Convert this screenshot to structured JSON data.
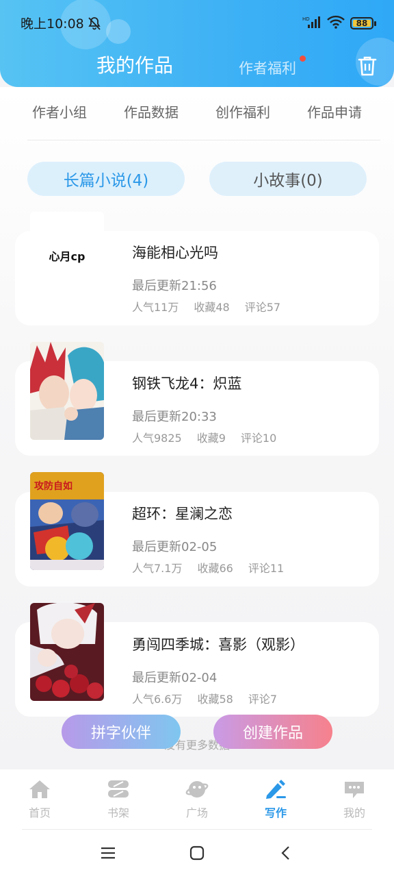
{
  "status_bar": {
    "time": "晚上10:08",
    "battery": "88",
    "network_label": "HD"
  },
  "header": {
    "tab_works": "我的作品",
    "tab_benefits": "作者福利",
    "trash_icon": "trash-icon"
  },
  "subnav": [
    "作者小组",
    "作品数据",
    "创作福利",
    "作品申请"
  ],
  "categories": {
    "novel": "长篇小说(4)",
    "story": "小故事(0)"
  },
  "works": [
    {
      "cover_text": "心月cp",
      "title": "海能相心光吗",
      "updated": "最后更新21:56",
      "popularity": "人气11万",
      "favorites": "收藏48",
      "comments": "评论57"
    },
    {
      "title": "钢铁飞龙4：炽蓝",
      "updated": "最后更新20:33",
      "popularity": "人气9825",
      "favorites": "收藏9",
      "comments": "评论10"
    },
    {
      "cover_text": "攻防自如",
      "title": "超环：星澜之恋",
      "updated": "最后更新02-05",
      "popularity": "人气7.1万",
      "favorites": "收藏66",
      "comments": "评论11"
    },
    {
      "title": "勇闯四季城：喜影（观影）",
      "updated": "最后更新02-04",
      "popularity": "人气6.6万",
      "favorites": "收藏58",
      "comments": "评论7"
    }
  ],
  "no_more": "没有更多数据",
  "actions": {
    "partner": "拼字伙伴",
    "create": "创建作品"
  },
  "tabbar": [
    {
      "label": "首页",
      "icon": "home-icon"
    },
    {
      "label": "书架",
      "icon": "bookshelf-icon"
    },
    {
      "label": "广场",
      "icon": "planet-icon"
    },
    {
      "label": "写作",
      "icon": "pen-icon"
    },
    {
      "label": "我的",
      "icon": "chat-icon"
    }
  ],
  "colors": {
    "accent": "#2b98e8",
    "header_gradient_start": "#56c3f3",
    "header_gradient_end": "#2fa8f6",
    "notification_dot": "#f24e3e"
  }
}
